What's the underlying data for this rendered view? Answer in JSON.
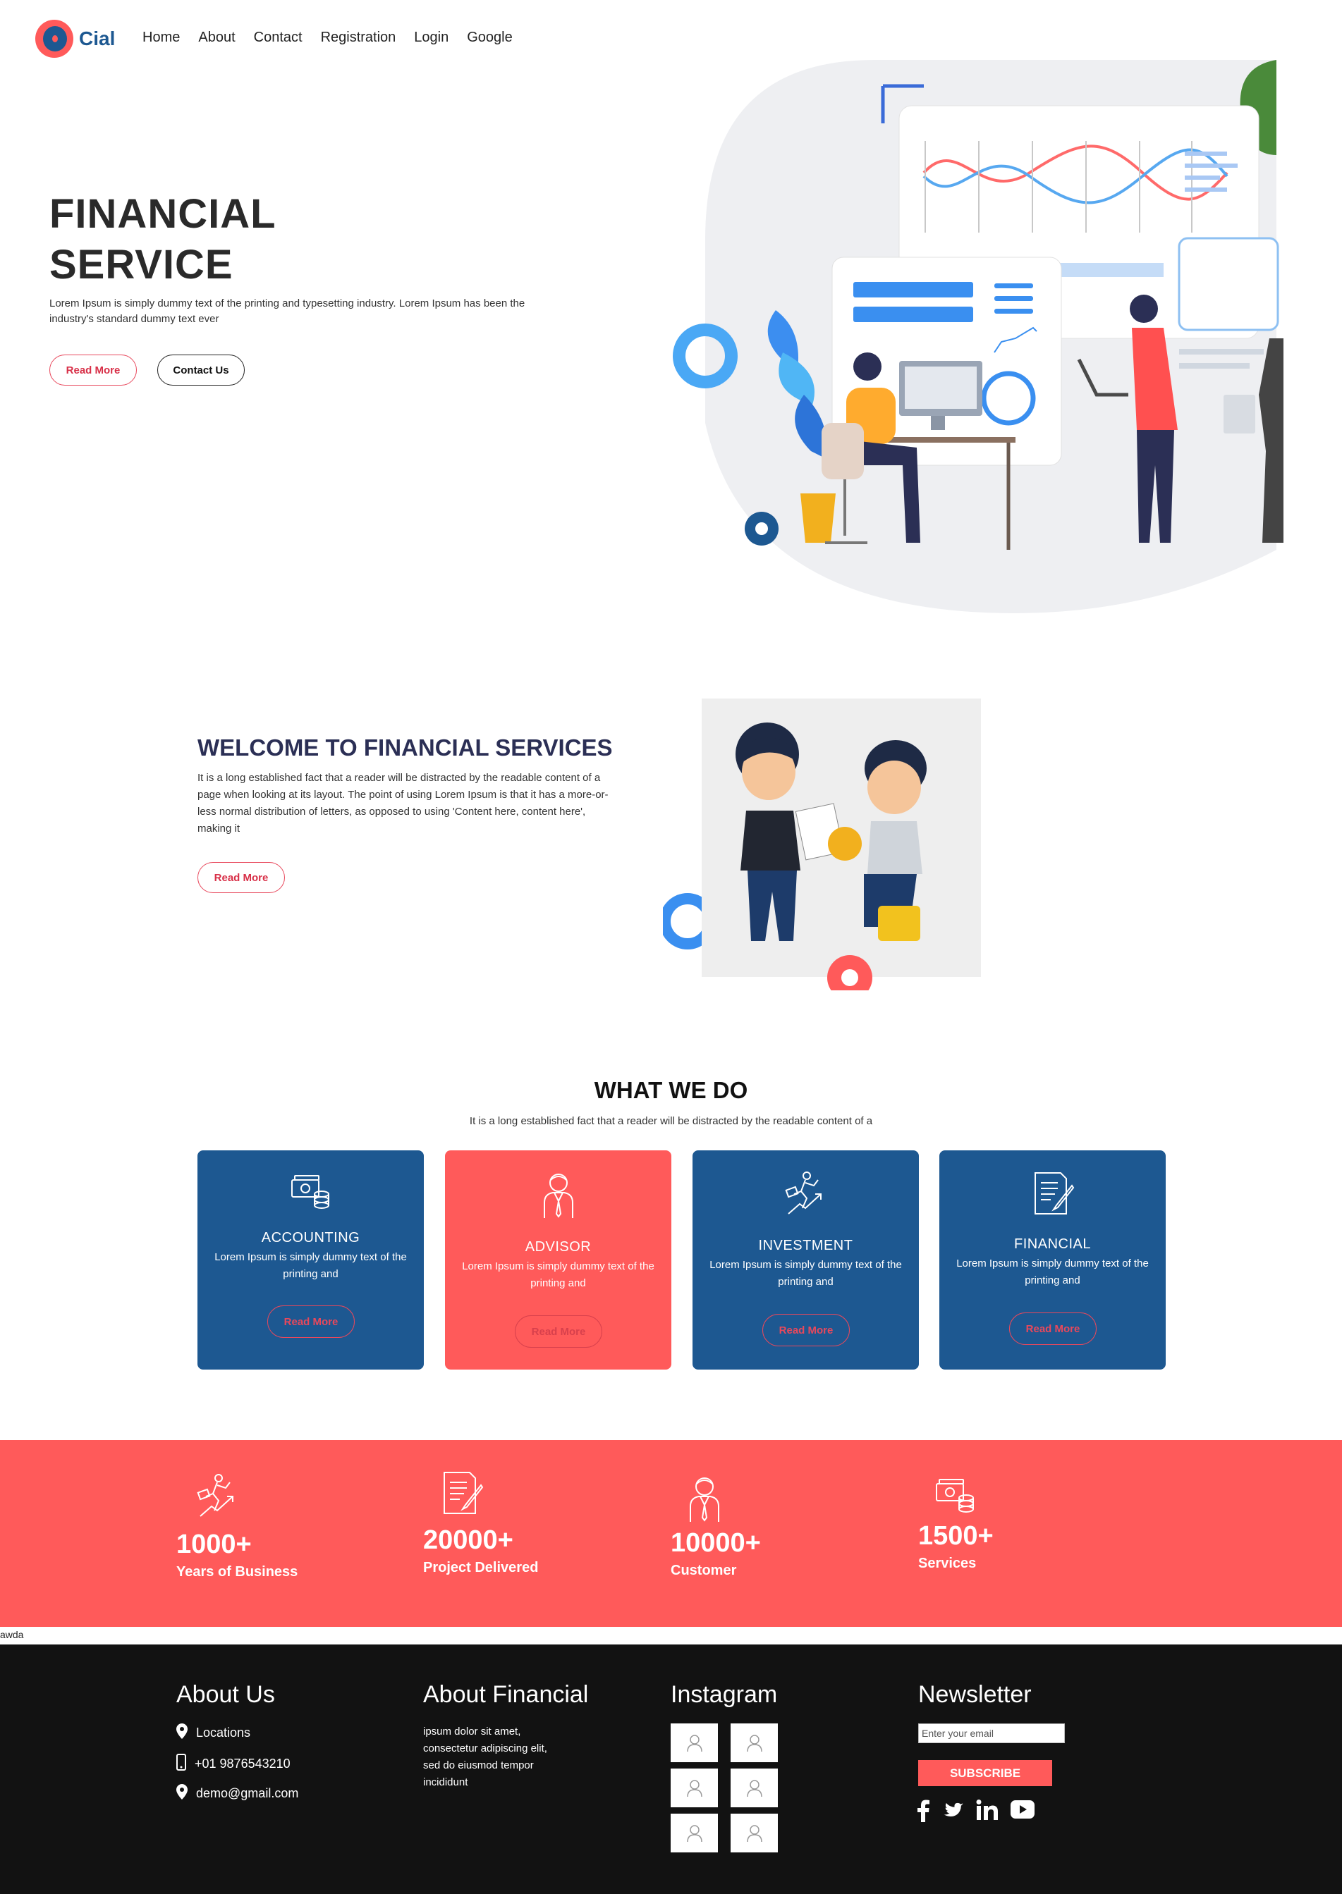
{
  "brand": {
    "name": "Cial"
  },
  "nav": [
    "Home",
    "About",
    "Contact",
    "Registration",
    "Login",
    "Google"
  ],
  "hero": {
    "title_line1": "FINANCIAL",
    "title_line2": "SERVICE",
    "text": "Lorem Ipsum is simply dummy text of the printing and typesetting industry. Lorem Ipsum has been the industry's standard dummy text ever",
    "btn_read_more": "Read More",
    "btn_contact": "Contact Us"
  },
  "welcome": {
    "title": "WELCOME TO FINANCIAL SERVICES",
    "text": "It is a long established fact that a reader will be distracted by the readable content of a page when looking at its layout. The point of using Lorem Ipsum is that it has a more-or-less normal distribution of letters, as opposed to using 'Content here, content here', making it",
    "btn": "Read More"
  },
  "what_we_do": {
    "title": "WHAT WE DO",
    "subtitle": "It is a long established fact that a reader will be distracted by the readable content of a",
    "cards": [
      {
        "title": "ACCOUNTING",
        "text": "Lorem Ipsum is simply dummy text of the printing and",
        "btn": "Read More",
        "icon": "money-icon"
      },
      {
        "title": "ADVISOR",
        "text": "Lorem Ipsum is simply dummy text of the printing and",
        "btn": "Read More",
        "icon": "advisor-icon"
      },
      {
        "title": "INVESTMENT",
        "text": "Lorem Ipsum is simply dummy text of the printing and",
        "btn": "Read More",
        "icon": "investment-icon"
      },
      {
        "title": "FINANCIAL",
        "text": "Lorem Ipsum is simply dummy text of the printing and",
        "btn": "Read More",
        "icon": "document-icon"
      }
    ]
  },
  "stats": [
    {
      "value": "1000+",
      "label": "Years of Business",
      "icon": "investment-icon"
    },
    {
      "value": "20000+",
      "label": "Project Delivered",
      "icon": "document-icon"
    },
    {
      "value": "10000+",
      "label": "Customer",
      "icon": "advisor-icon"
    },
    {
      "value": "1500+",
      "label": "Services",
      "icon": "money-icon"
    }
  ],
  "stray_text": "awda",
  "footer": {
    "about_title": "About Us",
    "location": "Locations",
    "phone": "+01 9876543210",
    "email": "demo@gmail.com",
    "financial_title": "About Financial",
    "financial_text": "ipsum dolor sit amet, consectetur adipiscing elit, sed do eiusmod tempor incididunt",
    "instagram_title": "Instagram",
    "newsletter_title": "Newsletter",
    "email_placeholder": "Enter your email",
    "subscribe": "SUBSCRIBE"
  },
  "colors": {
    "brand_blue": "#1d5891",
    "brand_red": "#ff5a5a",
    "footer_bg": "#121212"
  }
}
